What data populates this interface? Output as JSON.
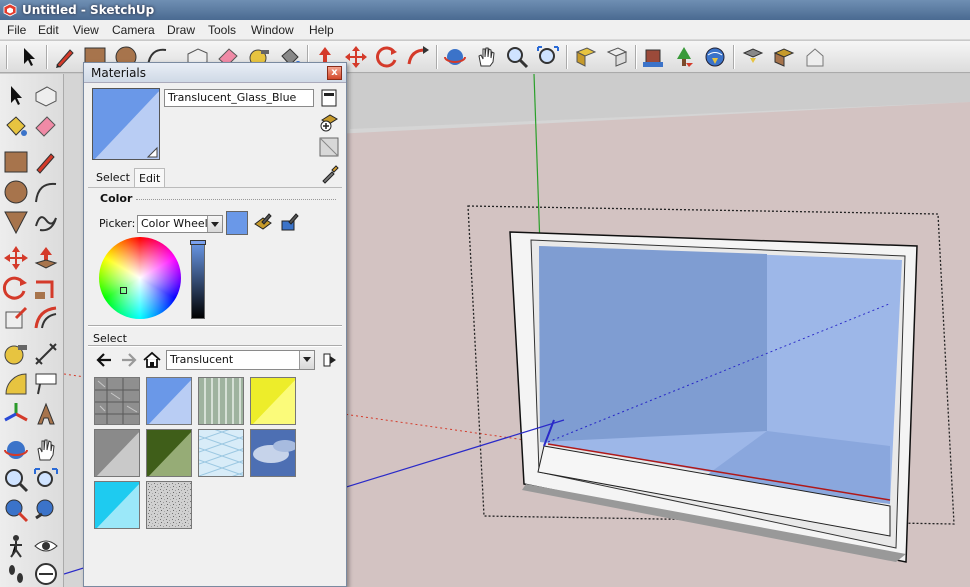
{
  "window": {
    "title": "Untitled - SketchUp",
    "logo_icon": "sketchup-logo-icon"
  },
  "menubar": {
    "items": [
      "File",
      "Edit",
      "View",
      "Camera",
      "Draw",
      "Tools",
      "Window",
      "Help"
    ]
  },
  "materials_panel": {
    "title": "Materials",
    "close_label": "x",
    "material_name": "Translucent_Glass_Blue",
    "tabs": [
      "Select",
      "Edit"
    ],
    "active_tab": "Edit",
    "color_heading": "Color",
    "picker_label": "Picker:",
    "picker_value": "Color Wheel",
    "select_heading": "Select",
    "collection_value": "Translucent",
    "colors": {
      "glass_blue": "#6a98e8",
      "accent_title": "#4a6a91"
    }
  }
}
